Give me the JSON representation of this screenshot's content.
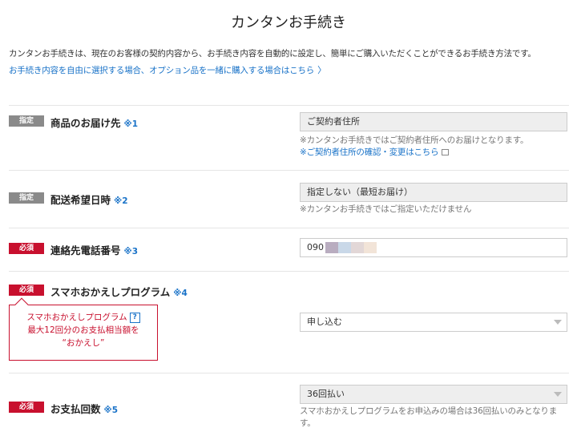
{
  "page": {
    "title": "カンタンお手続き",
    "intro": "カンタンお手続きは、現在のお客様の契約内容から、お手続き内容を自動的に設定し、簡単にご購入いただくことができるお手続き方法です。",
    "intro_link": "お手続き内容を自由に選択する場合、オプション品を一緒に購入する場合はこちら",
    "intro_link_icon": "chevron-right-icon"
  },
  "colors": {
    "accent_blue": "#1a73c8",
    "required_red": "#c8102e",
    "fixed_gray": "#8a8a8a"
  },
  "rows": {
    "delivery": {
      "badge": "指定",
      "label": "商品のお届け先",
      "note": "※1",
      "value": "ご契約者住所",
      "help": "※カンタンお手続きではご契約者住所へのお届けとなります。",
      "link": "※ご契約者住所の確認・変更はこちら"
    },
    "delivery_time": {
      "badge": "指定",
      "label": "配送希望日時",
      "note": "※2",
      "value": "指定しない（最短お届け）",
      "help": "※カンタンお手続きではご指定いただけません"
    },
    "phone": {
      "badge": "必須",
      "label": "連絡先電話番号",
      "note": "※3",
      "value_prefix": "090",
      "masked_colors": [
        "#b9adc0",
        "#c9d8e8",
        "#e2d7d7",
        "#f2e4d8"
      ]
    },
    "smartphone": {
      "badge": "必須",
      "label": "スマホおかえしプログラム",
      "note": "※4",
      "value": "申し込む",
      "callout_line1": "スマホおかえしプログラム",
      "callout_help": "?",
      "callout_line2": "最大12回分のお支払相当額を",
      "callout_line3": "“おかえし”"
    },
    "installments": {
      "badge": "必須",
      "label": "お支払回数",
      "note": "※5",
      "value": "36回払い",
      "help_line1": "スマホおかえしプログラムをお申込みの場合は36回払いのみとなりま",
      "help_line2": "す。"
    }
  }
}
